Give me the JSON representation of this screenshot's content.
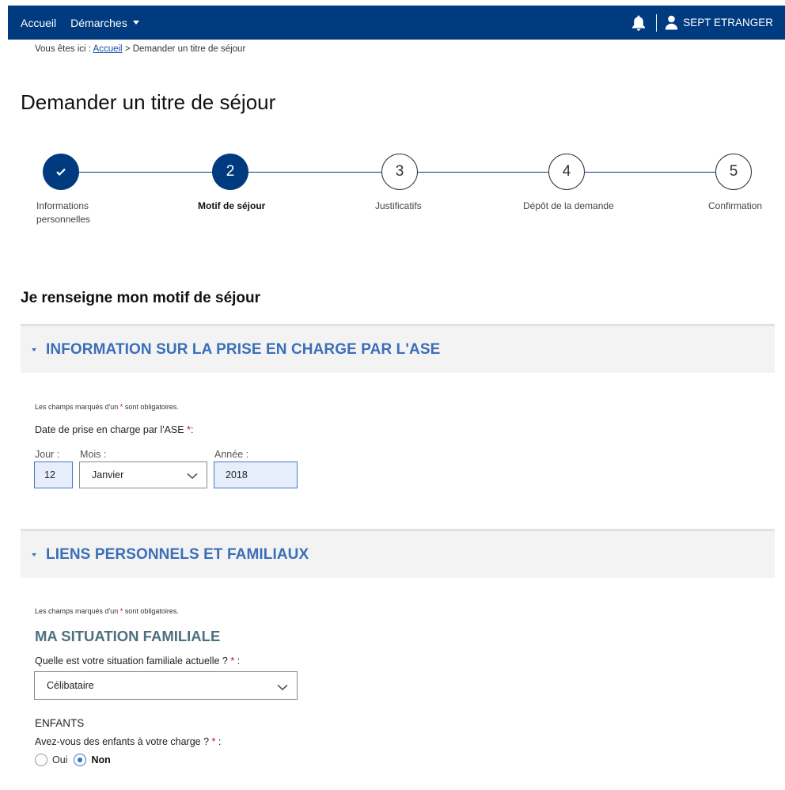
{
  "topbar": {
    "home_label": "Accueil",
    "procedures_label": "Démarches",
    "user_name": "SEPT ETRANGER"
  },
  "breadcrumb": {
    "prefix": "Vous êtes ici :",
    "home_link": "Accueil",
    "separator": ">",
    "current": "Demander un titre de séjour"
  },
  "page_title": "Demander un titre de séjour",
  "stepper": {
    "current_step": 2,
    "steps": [
      {
        "number": "✔",
        "label_line1": "Informations",
        "label_line2": "personnelles",
        "state": "done"
      },
      {
        "number": "2",
        "label_line1": "Motif de séjour",
        "label_line2": "",
        "state": "active"
      },
      {
        "number": "3",
        "label_line1": "Justificatifs",
        "label_line2": "",
        "state": "todo"
      },
      {
        "number": "4",
        "label_line1": "Dépôt de la demande",
        "label_line2": "",
        "state": "todo"
      },
      {
        "number": "5",
        "label_line1": "Confirmation",
        "label_line2": "",
        "state": "todo"
      }
    ]
  },
  "section_title": "Je renseigne mon motif de séjour",
  "panel_ase": {
    "title": "INFORMATION SUR LA PRISE EN CHARGE PAR L'ASE",
    "required_note_pre": "Les champs marqués d'un",
    "required_note_star": "*",
    "required_note_post": "sont obligatoires.",
    "date_label": "Date de prise en charge par l'ASE",
    "date_label_star": "*",
    "date_label_colon": ":",
    "day_label": "Jour :",
    "month_label": "Mois :",
    "year_label": "Année :",
    "day_value": "12",
    "month_value": "Janvier",
    "year_value": "2018"
  },
  "panel_family": {
    "title": "LIENS PERSONNELS ET FAMILIAUX",
    "required_note_pre": "Les champs marqués d'un",
    "required_note_star": "*",
    "required_note_post": "sont obligatoires.",
    "subheading": "MA SITUATION FAMILIALE",
    "situation_label": "Quelle est votre situation familiale actuelle ?",
    "situation_star": "*",
    "situation_colon": ":",
    "situation_value": "Célibataire",
    "children_heading": "ENFANTS",
    "children_question": "Avez-vous des enfants à votre charge ?",
    "children_star": "*",
    "children_colon": ":",
    "option_yes": "Oui",
    "option_no": "Non",
    "selected": "Non"
  },
  "colors": {
    "navbar": "#003b80",
    "accent": "#3a6fb8",
    "subheading": "#4d7080",
    "required": "#d0021b"
  },
  "icons": [
    "caret-down-icon",
    "bell-icon",
    "user-icon",
    "check-icon",
    "chevron-down-icon"
  ]
}
